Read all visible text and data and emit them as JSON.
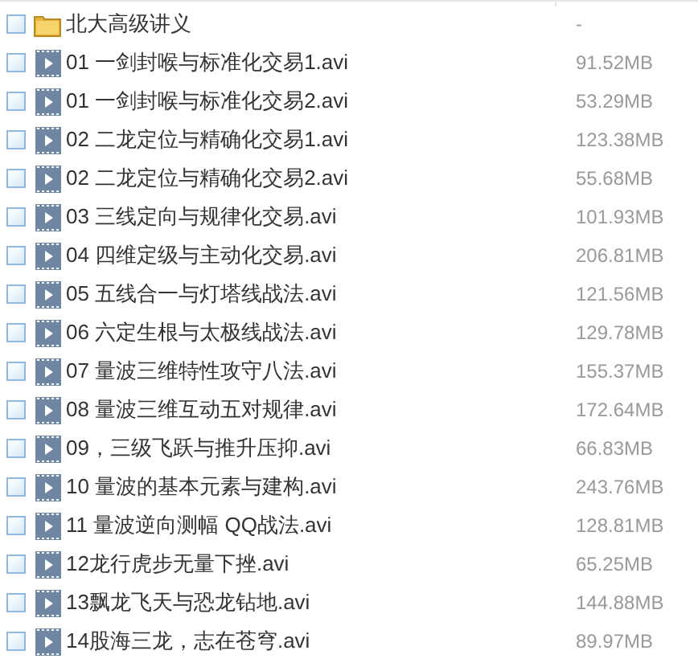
{
  "files": [
    {
      "kind": "folder",
      "name": "北大高级讲义",
      "size": "-",
      "checked": false
    },
    {
      "kind": "video",
      "name": "01 一剑封喉与标准化交易1.avi",
      "size": "91.52MB",
      "checked": false
    },
    {
      "kind": "video",
      "name": "01 一剑封喉与标准化交易2.avi",
      "size": "53.29MB",
      "checked": false
    },
    {
      "kind": "video",
      "name": "02 二龙定位与精确化交易1.avi",
      "size": "123.38MB",
      "checked": false
    },
    {
      "kind": "video",
      "name": "02 二龙定位与精确化交易2.avi",
      "size": "55.68MB",
      "checked": false
    },
    {
      "kind": "video",
      "name": "03 三线定向与规律化交易.avi",
      "size": "101.93MB",
      "checked": false
    },
    {
      "kind": "video",
      "name": "04 四维定级与主动化交易.avi",
      "size": "206.81MB",
      "checked": false
    },
    {
      "kind": "video",
      "name": "05 五线合一与灯塔线战法.avi",
      "size": "121.56MB",
      "checked": false
    },
    {
      "kind": "video",
      "name": "06 六定生根与太极线战法.avi",
      "size": "129.78MB",
      "checked": false
    },
    {
      "kind": "video",
      "name": "07 量波三维特性攻守八法.avi",
      "size": "155.37MB",
      "checked": false
    },
    {
      "kind": "video",
      "name": "08 量波三维互动五对规律.avi",
      "size": "172.64MB",
      "checked": false
    },
    {
      "kind": "video",
      "name": "09，三级飞跃与推升压抑.avi",
      "size": "66.83MB",
      "checked": false
    },
    {
      "kind": "video",
      "name": "10 量波的基本元素与建构.avi",
      "size": "243.76MB",
      "checked": false
    },
    {
      "kind": "video",
      "name": "11 量波逆向测幅 QQ战法.avi",
      "size": "128.81MB",
      "checked": false
    },
    {
      "kind": "video",
      "name": "12龙行虎步无量下挫.avi",
      "size": "65.25MB",
      "checked": false
    },
    {
      "kind": "video",
      "name": "13飘龙飞天与恐龙钻地.avi",
      "size": "144.88MB",
      "checked": false
    },
    {
      "kind": "video",
      "name": "14股海三龙，志在苍穹.avi",
      "size": "89.97MB",
      "checked": false
    }
  ]
}
